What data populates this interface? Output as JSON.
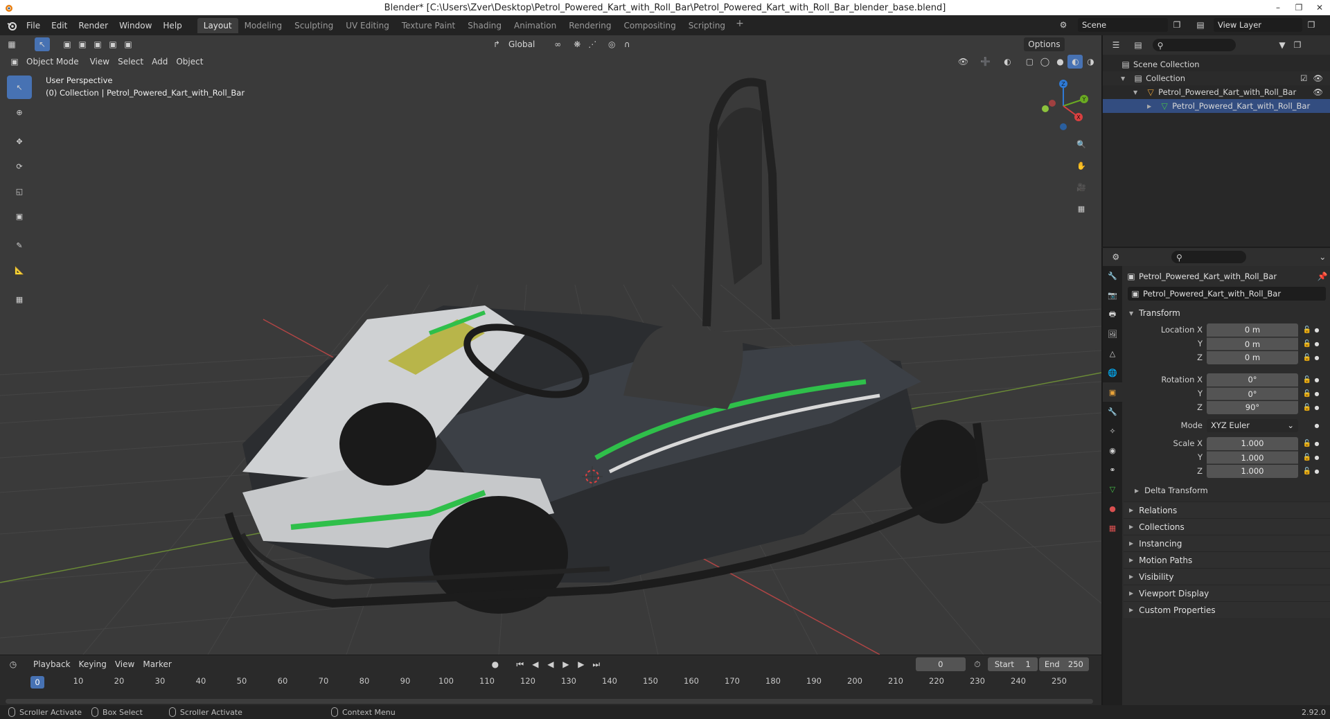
{
  "window": {
    "title": "Blender* [C:\\Users\\Zver\\Desktop\\Petrol_Powered_Kart_with_Roll_Bar\\Petrol_Powered_Kart_with_Roll_Bar_blender_base.blend]",
    "controls": [
      "–",
      "❐",
      "✕"
    ]
  },
  "topbar": {
    "menus": [
      "File",
      "Edit",
      "Render",
      "Window",
      "Help"
    ],
    "workspaces": [
      "Layout",
      "Modeling",
      "Sculpting",
      "UV Editing",
      "Texture Paint",
      "Shading",
      "Animation",
      "Rendering",
      "Compositing",
      "Scripting"
    ],
    "active_workspace": "Layout",
    "scene": "Scene",
    "view_layer": "View Layer"
  },
  "viewport": {
    "mode": "Object Mode",
    "menus": [
      "View",
      "Select",
      "Add",
      "Object"
    ],
    "transform_orientation": "Global",
    "options_label": "Options",
    "perspective_label": "User Perspective",
    "collection_label": "(0) Collection | Petrol_Powered_Kart_with_Roll_Bar",
    "gizmo_axes": {
      "x": "X",
      "y": "Y",
      "z": "Z"
    },
    "colors": {
      "background": "#3a3a3a",
      "grid": "#4a4a4a",
      "x_axis": "#c04a4a",
      "y_axis": "#7a9a3a",
      "accent_green": "#2fbf4a"
    }
  },
  "timeline": {
    "menus": [
      "Playback",
      "Keying",
      "View",
      "Marker"
    ],
    "current_frame": "0",
    "start_label": "Start",
    "start_value": "1",
    "end_label": "End",
    "end_value": "250",
    "ruler": [
      "0",
      "10",
      "20",
      "30",
      "40",
      "50",
      "60",
      "70",
      "80",
      "90",
      "100",
      "110",
      "120",
      "130",
      "140",
      "150",
      "160",
      "170",
      "180",
      "190",
      "200",
      "210",
      "220",
      "230",
      "240",
      "250"
    ]
  },
  "statusbar": {
    "items": [
      "Scroller Activate",
      "Box Select",
      "Scroller Activate",
      "Context Menu"
    ],
    "version": "2.92.0"
  },
  "outliner": {
    "root": "Scene Collection",
    "collection": "Collection",
    "object": "Petrol_Powered_Kart_with_Roll_Bar",
    "mesh": "Petrol_Powered_Kart_with_Roll_Bar"
  },
  "properties": {
    "object_name": "Petrol_Powered_Kart_with_Roll_Bar",
    "object_field": "Petrol_Powered_Kart_with_Roll_Bar",
    "transform_title": "Transform",
    "location_label": "Location X",
    "location": [
      "0 m",
      "0 m",
      "0 m"
    ],
    "rotation_label": "Rotation X",
    "rotation": [
      "0°",
      "0°",
      "90°"
    ],
    "mode_label": "Mode",
    "mode_value": "XYZ Euler",
    "scale_label": "Scale X",
    "scale": [
      "1.000",
      "1.000",
      "1.000"
    ],
    "axis_y": "Y",
    "axis_z": "Z",
    "delta_transform": "Delta Transform",
    "panels": [
      "Relations",
      "Collections",
      "Instancing",
      "Motion Paths",
      "Visibility",
      "Viewport Display",
      "Custom Properties"
    ]
  }
}
